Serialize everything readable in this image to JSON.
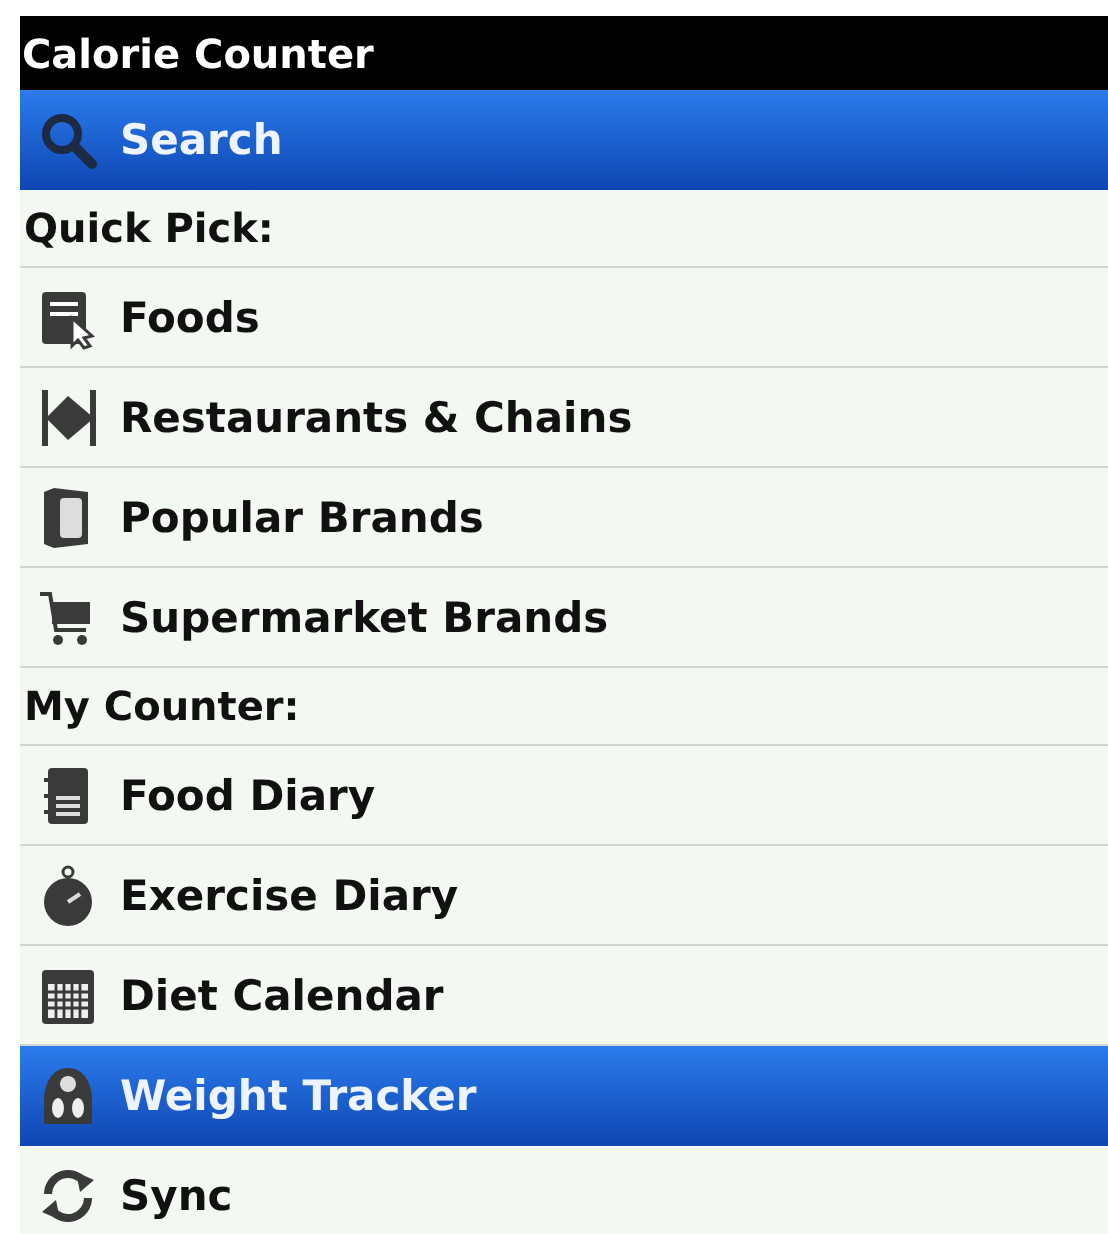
{
  "title": "Calorie Counter",
  "search": {
    "label": "Search",
    "selected": true
  },
  "sections": [
    {
      "heading": "Quick Pick:",
      "items": [
        {
          "label": "Foods",
          "selected": false
        },
        {
          "label": "Restaurants & Chains",
          "selected": false
        },
        {
          "label": "Popular Brands",
          "selected": false
        },
        {
          "label": "Supermarket Brands",
          "selected": false
        }
      ]
    },
    {
      "heading": "My Counter:",
      "items": [
        {
          "label": "Food Diary",
          "selected": false
        },
        {
          "label": "Exercise Diary",
          "selected": false
        },
        {
          "label": "Diet Calendar",
          "selected": false
        },
        {
          "label": "Weight Tracker",
          "selected": true
        },
        {
          "label": "Sync",
          "selected": false
        }
      ]
    }
  ]
}
